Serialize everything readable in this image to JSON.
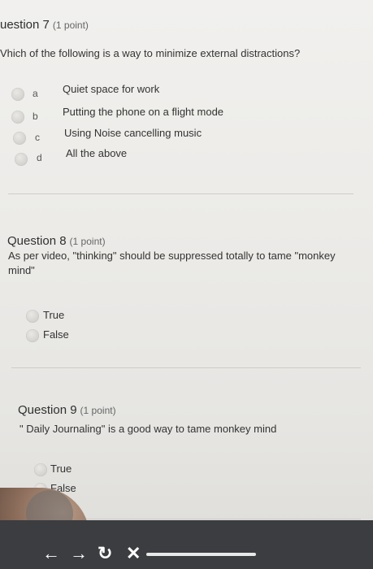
{
  "q7": {
    "title": "uestion 7",
    "points": "(1 point)",
    "text": "Vhich of the following is a way to minimize external distractions?",
    "options": [
      {
        "letter": "a",
        "label": "Quiet space for work"
      },
      {
        "letter": "b",
        "label": "Putting the phone on a flight mode"
      },
      {
        "letter": "c",
        "label": "Using Noise cancelling music"
      },
      {
        "letter": "d",
        "label": "All the above"
      }
    ]
  },
  "q8": {
    "title": "Question 8",
    "points": "(1 point)",
    "text": "As per video, \"thinking\" should be suppressed totally to tame \"monkey mind\"",
    "options": [
      "True",
      "False"
    ]
  },
  "q9": {
    "title": "Question 9",
    "points": "(1 point)",
    "text": "\" Daily Journaling\" is a good way to tame monkey mind",
    "options": [
      "True",
      "False"
    ]
  },
  "nav": {
    "back_icon": "←",
    "forward_icon": "→",
    "refresh_icon": "↻",
    "close_icon": "✕"
  }
}
